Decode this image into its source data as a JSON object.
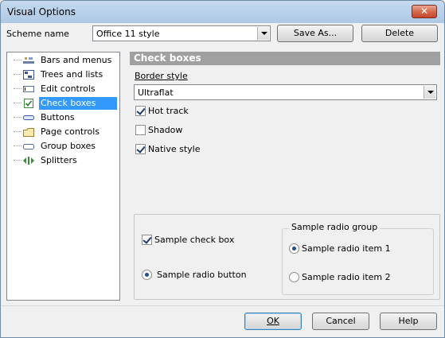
{
  "window": {
    "title": "Visual Options",
    "close_glyph": "✕"
  },
  "scheme": {
    "label": "Scheme name",
    "value": "Office 11 style",
    "save_as_label": "Save As...",
    "delete_label": "Delete"
  },
  "tree": {
    "items": [
      {
        "label": "Bars and menus",
        "icon": "bars-menus-icon"
      },
      {
        "label": "Trees and lists",
        "icon": "tree-list-icon"
      },
      {
        "label": "Edit controls",
        "icon": "edit-control-icon"
      },
      {
        "label": "Check boxes",
        "icon": "checkbox-icon",
        "selected": true
      },
      {
        "label": "Buttons",
        "icon": "button-icon"
      },
      {
        "label": "Page controls",
        "icon": "page-control-icon"
      },
      {
        "label": "Group boxes",
        "icon": "group-box-icon"
      },
      {
        "label": "Splitters",
        "icon": "splitter-icon"
      }
    ]
  },
  "panel": {
    "header": "Check boxes",
    "border_style_label": "Border style",
    "border_style_value": "Ultraflat",
    "hot_track": {
      "label": "Hot track",
      "checked": true
    },
    "shadow": {
      "label": "Shadow",
      "checked": false
    },
    "native_style": {
      "label": "Native style",
      "checked": true
    }
  },
  "sample": {
    "check_box_label": "Sample check box",
    "check_box_checked": true,
    "radio_button_label": "Sample radio button",
    "radio_button_checked": true,
    "group_title": "Sample radio group",
    "radio_item_1": "Sample radio item 1",
    "radio_item_2": "Sample radio item 2",
    "selected_item": 1
  },
  "footer": {
    "ok_label": "OK",
    "cancel_label": "Cancel",
    "help_label": "Help"
  },
  "colors": {
    "selection": "#3399ff",
    "panel_header_bg": "#a0a0a0",
    "titlebar": "#b9d1ea",
    "close_button": "#d66c4e"
  }
}
